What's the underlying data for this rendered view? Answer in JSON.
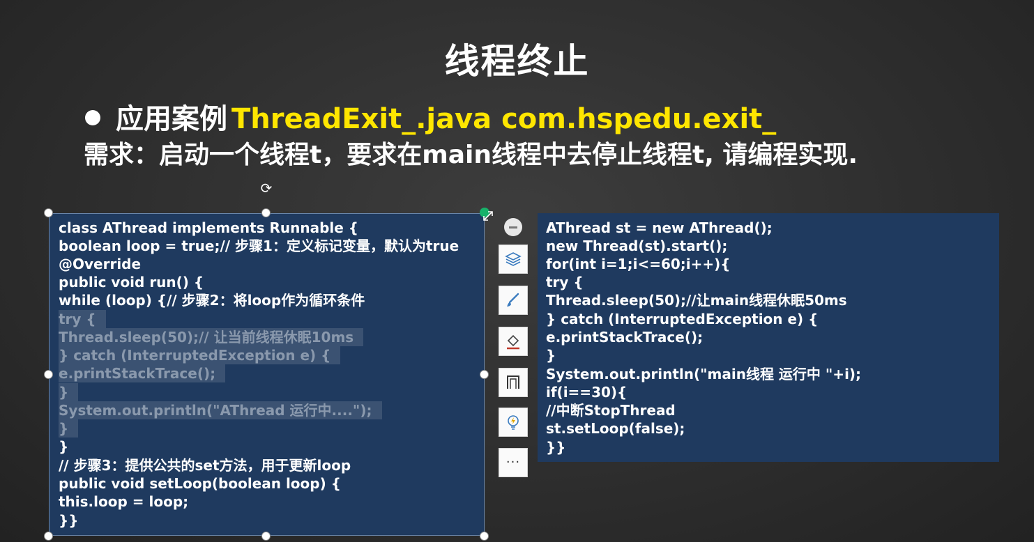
{
  "slide": {
    "title": "线程终止",
    "case_label": "应用案例",
    "case_file": "ThreadExit_.java com.hspedu.exit_",
    "requirement": "需求：启动一个线程t，要求在main线程中去停止线程t, 请编程实现."
  },
  "left_code": {
    "lines": [
      "class AThread implements Runnable {",
      "boolean loop = true;// 步骤1：定义标记变量，默认为true",
      "@Override",
      "public void run() {",
      "while (loop) {// 步骤2：将loop作为循环条件",
      "try {",
      "Thread.sleep(50);// 让当前线程休眠10ms",
      "} catch (InterruptedException e) {",
      "e.printStackTrace();",
      "}",
      "System.out.println(\"AThread 运行中....\");",
      "}",
      "}",
      "// 步骤3：提供公共的set方法，用于更新loop",
      "public void setLoop(boolean loop) {",
      "this.loop = loop;",
      "}}"
    ]
  },
  "right_code": {
    "lines": [
      "AThread st = new AThread();",
      "new Thread(st).start();",
      "for(int i=1;i<=60;i++){",
      "try {",
      "Thread.sleep(50);//让main线程休眠50ms",
      "} catch (InterruptedException e) {",
      "e.printStackTrace();",
      "}",
      "System.out.println(\"main线程 运行中 \"+i);",
      "if(i==30){",
      "//中断StopThread",
      "st.setLoop(false);",
      "}}"
    ]
  },
  "toolbar": {
    "icons": [
      "collapse-icon",
      "layers-icon",
      "brush-icon",
      "fill-icon",
      "frame-icon",
      "ideas-icon",
      "more-icon"
    ],
    "more_label": "···"
  },
  "colors": {
    "background": "#2e2e2e",
    "code_box": "#1f3a5f",
    "accent_yellow": "#ffe600",
    "selection": "#3b5272",
    "handle_green": "#17b26a"
  }
}
